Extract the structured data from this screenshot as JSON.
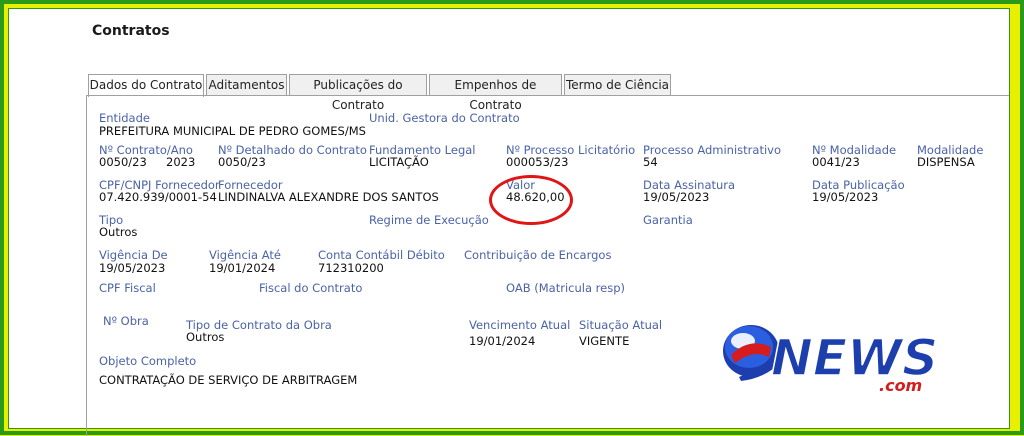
{
  "page": {
    "title": "Contratos"
  },
  "tabs": [
    {
      "label": "Dados do Contrato"
    },
    {
      "label": "Aditamentos"
    },
    {
      "label": "Publicações do Contrato"
    },
    {
      "label": "Empenhos de Contrato"
    },
    {
      "label": "Termo de Ciência"
    }
  ],
  "fields": {
    "entidade": {
      "label": "Entidade",
      "value": "PREFEITURA MUNICIPAL DE PEDRO GOMES/MS"
    },
    "unid_gestora": {
      "label": "Unid. Gestora do Contrato",
      "value": ""
    },
    "contrato_ano": {
      "label": "Nº Contrato/Ano",
      "value_numero": "0050/23",
      "value_ano": "2023"
    },
    "detalhado": {
      "label": "Nº Detalhado do Contrato",
      "value": "0050/23"
    },
    "fundamento": {
      "label": "Fundamento Legal",
      "value": "LICITAÇÃO"
    },
    "processo_licitatorio": {
      "label": "Nº Processo Licitatório",
      "value": "000053/23"
    },
    "processo_adm": {
      "label": "Processo Administrativo",
      "value": "54"
    },
    "n_modalidade": {
      "label": "Nº Modalidade",
      "value": "0041/23"
    },
    "modalidade": {
      "label": "Modalidade",
      "value": "DISPENSA"
    },
    "cpf_cnpj": {
      "label": "CPF/CNPJ Fornecedor",
      "value": "07.420.939/0001-54"
    },
    "fornecedor": {
      "label": "Fornecedor",
      "value": "LINDINALVA ALEXANDRE DOS SANTOS"
    },
    "valor": {
      "label": "Valor",
      "value": "48.620,00"
    },
    "data_assinatura": {
      "label": "Data Assinatura",
      "value": "19/05/2023"
    },
    "data_publicacao": {
      "label": "Data Publicação",
      "value": "19/05/2023"
    },
    "tipo": {
      "label": "Tipo",
      "value": "Outros"
    },
    "regime": {
      "label": "Regime de Execução",
      "value": ""
    },
    "garantia": {
      "label": "Garantia",
      "value": ""
    },
    "vigencia_de": {
      "label": "Vigência De",
      "value": "19/05/2023"
    },
    "vigencia_ate": {
      "label": "Vigência Até",
      "value": "19/01/2024"
    },
    "conta_contabil": {
      "label": "Conta Contábil Débito",
      "value": "712310200"
    },
    "contribuicao": {
      "label": "Contribuição de Encargos",
      "value": ""
    },
    "cpf_fiscal": {
      "label": "CPF Fiscal",
      "value": ""
    },
    "fiscal": {
      "label": "Fiscal do Contrato",
      "value": ""
    },
    "oab": {
      "label": "OAB (Matricula resp)",
      "value": ""
    },
    "n_obra": {
      "label": "Nº Obra",
      "value": ""
    },
    "tipo_obra": {
      "label": "Tipo de Contrato da Obra",
      "value": "Outros"
    },
    "vencimento": {
      "label": "Vencimento Atual",
      "value": "19/01/2024"
    },
    "situacao": {
      "label": "Situação Atual",
      "value": "VIGENTE"
    },
    "objeto": {
      "label": "Objeto Completo",
      "value": "CONTRATAÇÃO DE SERVIÇO DE ARBITRAGEM"
    }
  },
  "watermark": {
    "brand": "NEWS",
    "suffix": ".com"
  },
  "colors": {
    "label": "#4a63a6",
    "highlight_circle": "#e01515",
    "frame_green": "#2a9a1a",
    "frame_yellow": "#e8ef00",
    "logo_blue": "#1d3fae",
    "logo_red": "#d61c1c"
  }
}
